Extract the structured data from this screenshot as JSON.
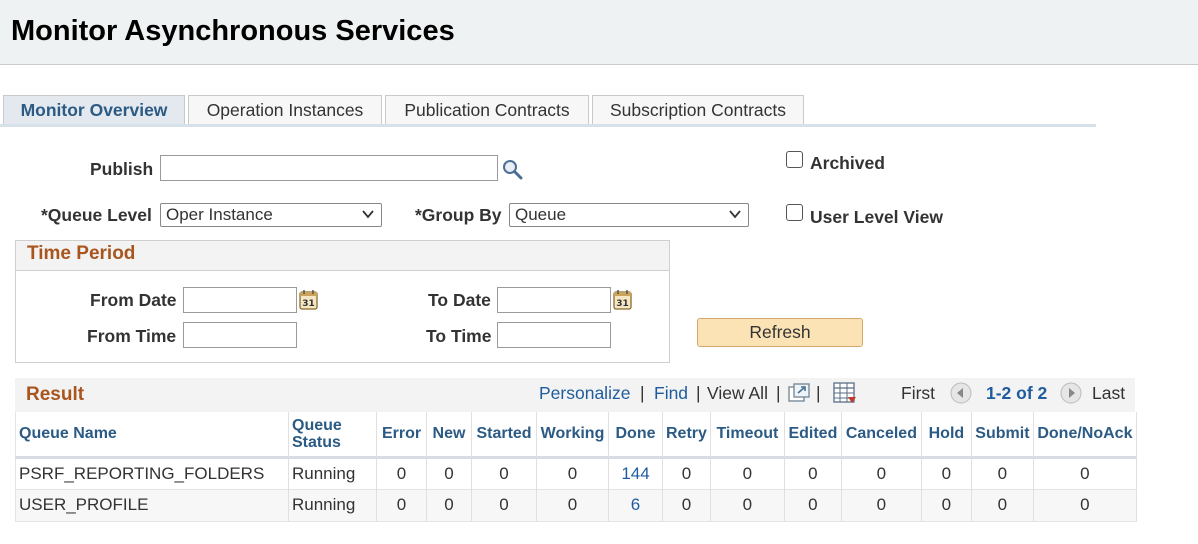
{
  "page": {
    "title": "Monitor Asynchronous Services"
  },
  "tabs": [
    {
      "label": "Monitor Overview",
      "active": true
    },
    {
      "label": "Operation Instances",
      "active": false
    },
    {
      "label": "Publication Contracts",
      "active": false
    },
    {
      "label": "Subscription Contracts",
      "active": false
    }
  ],
  "filters": {
    "publish_label": "Publish",
    "publish_value": "",
    "archived_label": "Archived",
    "archived_checked": false,
    "queue_level_label": "*Queue Level",
    "queue_level_value": "Oper Instance",
    "group_by_label": "*Group By",
    "group_by_value": "Queue",
    "user_level_view_label": "User Level View",
    "user_level_view_checked": false
  },
  "time_period": {
    "title": "Time Period",
    "from_date_label": "From Date",
    "to_date_label": "To Date",
    "from_time_label": "From Time",
    "to_time_label": "To Time",
    "from_date": "",
    "to_date": "",
    "from_time": "",
    "to_time": "",
    "calendar_day": "31"
  },
  "refresh_label": "Refresh",
  "result": {
    "title": "Result",
    "personalize": "Personalize",
    "find": "Find",
    "view_all": "View All",
    "first": "First",
    "range": "1-2 of 2",
    "last": "Last",
    "sep": "|",
    "columns": [
      "Queue Name",
      "Queue Status",
      "Error",
      "New",
      "Started",
      "Working",
      "Done",
      "Retry",
      "Timeout",
      "Edited",
      "Canceled",
      "Hold",
      "Submit",
      "Done/NoAck"
    ],
    "rows": [
      [
        "PSRF_REPORTING_FOLDERS",
        "Running",
        "0",
        "0",
        "0",
        "0",
        "144",
        "0",
        "0",
        "0",
        "0",
        "0",
        "0",
        "0"
      ],
      [
        "USER_PROFILE",
        "Running",
        "0",
        "0",
        "0",
        "0",
        "6",
        "0",
        "0",
        "0",
        "0",
        "0",
        "0",
        "0"
      ]
    ]
  },
  "colors": {
    "link": "#1f5c9e",
    "section_title": "#a8561e",
    "refresh_bg": "#fbe3b6",
    "header_bg": "#eef2f2"
  }
}
